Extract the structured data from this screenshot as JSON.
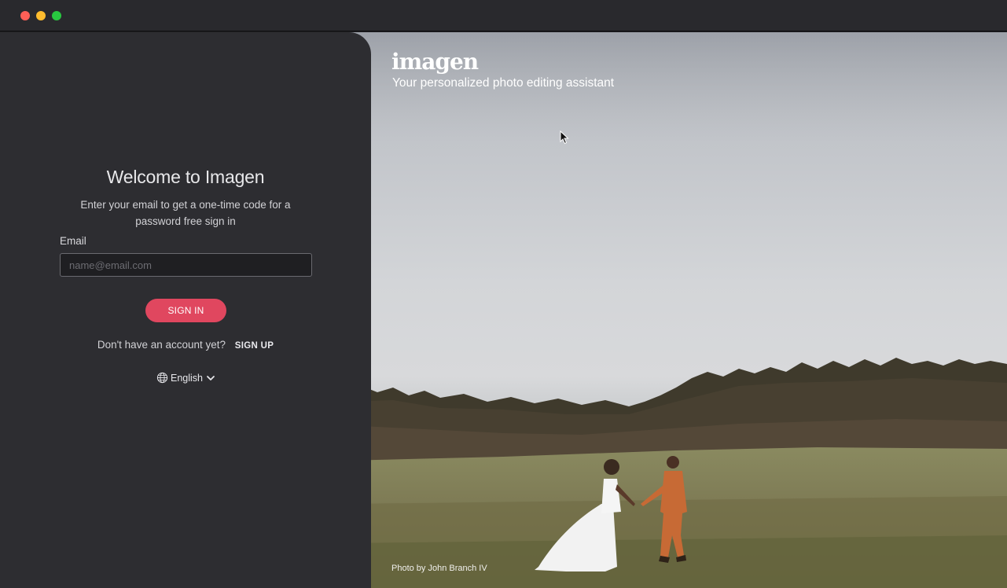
{
  "window": {
    "controls": [
      "close",
      "minimize",
      "zoom"
    ]
  },
  "login": {
    "title": "Welcome to Imagen",
    "subtitle": "Enter your email to get a one-time code for a password free sign in",
    "email_label": "Email",
    "email_placeholder": "name@email.com",
    "email_value": "",
    "signin_label": "SIGN IN",
    "no_account_text": "Don't have an account yet?",
    "signup_label": "SIGN UP",
    "language": "English"
  },
  "hero": {
    "logo_text": "imagen",
    "tagline": "Your personalized photo editing assistant",
    "photo_credit": "Photo by John Branch IV"
  },
  "colors": {
    "accent": "#e0475f",
    "panel": "#2d2d31",
    "titlebar": "#29292d"
  },
  "icons": {
    "language": "globe-icon",
    "dropdown": "chevron-down-icon"
  }
}
